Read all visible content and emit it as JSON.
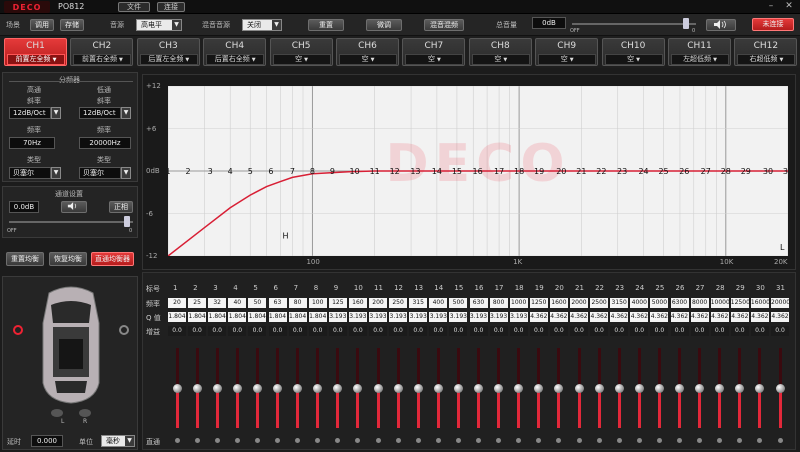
{
  "titlebar": {
    "app_name": "PO812",
    "menu_file": "文件",
    "menu_connect": "连接",
    "logo_text": "DECO",
    "minimize": "–",
    "close": "✕"
  },
  "toolbar": {
    "scene_label": "场景",
    "call_button": "调用",
    "save_button": "存储",
    "source_label": "音源",
    "source_value": "高电平",
    "mix_label": "混音音源",
    "mix_value": "关闭",
    "reset_button": "重置",
    "fine_tune_button": "微调",
    "mix_flag_button": "混音混频",
    "total_volume_label": "总音量",
    "total_volume_value": "0dB",
    "volume_level": 0.92,
    "volume_off": "OFF",
    "volume_max": "0",
    "connect_status_button": "未连接"
  },
  "channels": [
    {
      "name": "CH1",
      "assign": "前置左全频",
      "active": true
    },
    {
      "name": "CH2",
      "assign": "前置右全频",
      "active": false
    },
    {
      "name": "CH3",
      "assign": "后置左全频",
      "active": false
    },
    {
      "name": "CH4",
      "assign": "后置右全频",
      "active": false
    },
    {
      "name": "CH5",
      "assign": "空",
      "active": false
    },
    {
      "name": "CH6",
      "assign": "空",
      "active": false
    },
    {
      "name": "CH7",
      "assign": "空",
      "active": false
    },
    {
      "name": "CH8",
      "assign": "空",
      "active": false
    },
    {
      "name": "CH9",
      "assign": "空",
      "active": false
    },
    {
      "name": "CH10",
      "assign": "空",
      "active": false
    },
    {
      "name": "CH11",
      "assign": "左超低频",
      "active": false
    },
    {
      "name": "CH12",
      "assign": "右超低频",
      "active": false
    }
  ],
  "crossover": {
    "title": "分频器",
    "hp_label": "高通",
    "lp_label": "低通",
    "hp_slope_label": "斜率",
    "lp_slope_label": "斜率",
    "hp_slope": "12dB/Oct",
    "lp_slope": "12dB/Oct",
    "hp_freq_label": "频率",
    "lp_freq_label": "频率",
    "hp_freq": "70Hz",
    "lp_freq": "20000Hz",
    "hp_type_label": "类型",
    "lp_type_label": "类型",
    "hp_type": "贝塞尔",
    "lp_type": "贝塞尔"
  },
  "channel_settings": {
    "title": "通道设置",
    "gain": "0.0dB",
    "phase_button": "正相",
    "level": 0.95,
    "off": "OFF",
    "max": "0"
  },
  "eq_buttons": {
    "reset": "重置均衡",
    "restore": "恢复均衡",
    "bypass": "直通均衡器"
  },
  "delay": {
    "label": "延时",
    "value": "0.000",
    "unit_label": "单位",
    "unit_value": "毫秒"
  },
  "car_labels": {
    "left": "L",
    "right": "R"
  },
  "graph": {
    "y_ticks": [
      "+12",
      "+6",
      "0dB",
      "-6",
      "-12"
    ],
    "x_ticks": [
      "100",
      "1K",
      "10K",
      "20K"
    ],
    "marker_h": "H",
    "marker_l": "L",
    "watermark": "DECO"
  },
  "chart_data": {
    "type": "line",
    "xscale": "log",
    "xlim": [
      20,
      20000
    ],
    "ylim": [
      -12,
      12
    ],
    "x_tick_labels": [
      "100",
      "1K",
      "10K",
      "20K"
    ],
    "y_tick_labels": [
      "+12",
      "+6",
      "0dB",
      "-6",
      "-12"
    ],
    "series": [
      {
        "x": [
          20,
          30,
          40,
          50,
          60,
          70,
          80,
          100,
          150,
          200,
          500,
          1000,
          5000,
          10000,
          20000
        ],
        "y": [
          -12,
          -8,
          -5.2,
          -3.4,
          -2.2,
          -1.5,
          -0.9,
          -0.4,
          -0.1,
          0,
          0,
          0,
          0,
          0,
          0
        ]
      }
    ],
    "band_numbers": [
      1,
      2,
      3,
      4,
      5,
      6,
      7,
      8,
      9,
      10,
      11,
      12,
      13,
      14,
      15,
      16,
      17,
      18,
      19,
      20,
      21,
      22,
      23,
      24,
      25,
      26,
      27,
      28,
      29,
      30,
      31
    ],
    "grid": true
  },
  "eq_table": {
    "row_band": "标号",
    "row_freq": "频率",
    "row_q": "Q 值",
    "row_gain": "增益",
    "row_bypass": "直通",
    "bands": [
      "1",
      "2",
      "3",
      "4",
      "5",
      "6",
      "7",
      "8",
      "9",
      "10",
      "11",
      "12",
      "13",
      "14",
      "15",
      "16",
      "17",
      "18",
      "19",
      "20",
      "21",
      "22",
      "23",
      "24",
      "25",
      "26",
      "27",
      "28",
      "29",
      "30",
      "31"
    ],
    "freqs": [
      "20",
      "25",
      "32",
      "40",
      "50",
      "63",
      "80",
      "100",
      "125",
      "160",
      "200",
      "250",
      "315",
      "400",
      "500",
      "630",
      "800",
      "1000",
      "1250",
      "1600",
      "2000",
      "2500",
      "3150",
      "4000",
      "5000",
      "6300",
      "8000",
      "10000",
      "12500",
      "16000",
      "20000"
    ],
    "q": [
      "1.804",
      "1.804",
      "1.804",
      "1.804",
      "1.804",
      "1.804",
      "1.804",
      "1.804",
      "3.193",
      "3.193",
      "3.193",
      "3.193",
      "3.193",
      "3.193",
      "3.193",
      "3.193",
      "3.193",
      "3.193",
      "4.362",
      "4.362",
      "4.362",
      "4.362",
      "4.362",
      "4.362",
      "4.362",
      "4.362",
      "4.362",
      "4.362",
      "4.362",
      "4.362",
      "4.362"
    ],
    "gains": [
      "0.0",
      "0.0",
      "0.0",
      "0.0",
      "0.0",
      "0.0",
      "0.0",
      "0.0",
      "0.0",
      "0.0",
      "0.0",
      "0.0",
      "0.0",
      "0.0",
      "0.0",
      "0.0",
      "0.0",
      "0.0",
      "0.0",
      "0.0",
      "0.0",
      "0.0",
      "0.0",
      "0.0",
      "0.0",
      "0.0",
      "0.0",
      "0.0",
      "0.0",
      "0.0",
      "0.0"
    ],
    "fader_levels": [
      0.5,
      0.5,
      0.5,
      0.5,
      0.5,
      0.5,
      0.5,
      0.5,
      0.5,
      0.5,
      0.5,
      0.5,
      0.5,
      0.5,
      0.5,
      0.5,
      0.5,
      0.5,
      0.5,
      0.5,
      0.5,
      0.5,
      0.5,
      0.5,
      0.5,
      0.5,
      0.5,
      0.5,
      0.5,
      0.5,
      0.5
    ]
  },
  "colors": {
    "accent": "#e2283a",
    "curve": "#d81f35",
    "bg": "#1c1c1c",
    "panel": "#242424"
  }
}
